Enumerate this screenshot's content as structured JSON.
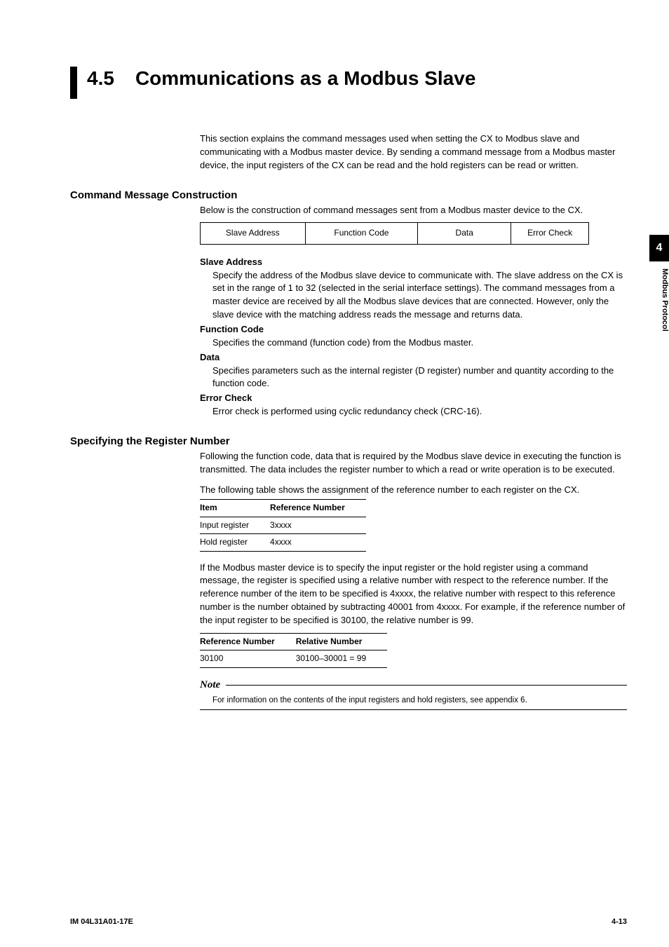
{
  "chapter_tab": {
    "num": "4",
    "label": "Modbus Protocol"
  },
  "title": {
    "num": "4.5",
    "text": "Communications as a Modbus Slave"
  },
  "intro": "This section explains the command messages used when setting the CX to Modbus slave and communicating with a Modbus master device.  By sending a command message from a Modbus master device, the input registers of the CX can be read and the hold registers can be read or written.",
  "sec1": {
    "heading": "Command Message Construction",
    "lead": "Below is the construction of command messages sent from a Modbus master device to the CX.",
    "cells": [
      "Slave Address",
      "Function Code",
      "Data",
      "Error Check"
    ],
    "items": [
      {
        "head": "Slave Address",
        "body": "Specify the address of the Modbus slave device to communicate with.  The slave address on the CX is set in the range of 1 to 32 (selected in the serial interface settings).  The command messages from a master device are received by all the Modbus slave devices that are connected.  However, only the slave device with the matching address reads the message and returns data."
      },
      {
        "head": "Function Code",
        "body": "Specifies the command (function code) from the Modbus master."
      },
      {
        "head": "Data",
        "body": "Specifies parameters such as the internal register (D register) number and quantity according to the function code."
      },
      {
        "head": "Error Check",
        "body": "Error check is performed using cyclic redundancy check (CRC-16)."
      }
    ]
  },
  "sec2": {
    "heading": "Specifying the Register Number",
    "p1": "Following the function code, data that is required by the Modbus slave device in executing the function is transmitted.  The data includes the register number to which a read or write operation is to be executed.",
    "p2": "The following table shows the assignment of the reference number to each register on the CX.",
    "tbl1": {
      "h1": "Item",
      "h2": "Reference Number",
      "rows": [
        [
          "Input register",
          "3xxxx"
        ],
        [
          "Hold register",
          "4xxxx"
        ]
      ]
    },
    "p3": "If the Modbus master device is to specify the input register or the hold register using a command message, the register is specified using a relative number with respect to the reference number.  If the reference number of the item to be specified is 4xxxx, the relative number with respect to this reference number is the number obtained by subtracting 40001 from 4xxxx.  For example, if the reference number of the input register to be specified is 30100, the relative number is 99.",
    "tbl2": {
      "h1": "Reference Number",
      "h2": "Relative Number",
      "rows": [
        [
          "30100",
          "30100–30001 = 99"
        ]
      ]
    }
  },
  "note": {
    "label": "Note",
    "body": "For information on the contents of the input registers and hold registers, see appendix 6."
  },
  "footer": {
    "left": "IM 04L31A01-17E",
    "right": "4-13"
  }
}
